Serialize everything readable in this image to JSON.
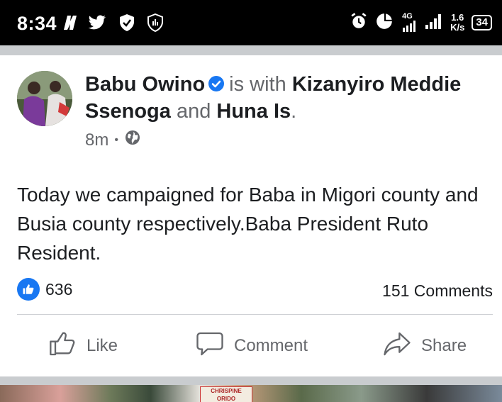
{
  "status_bar": {
    "time": "8:34",
    "network_type": "4G",
    "net_speed_value": "1.6",
    "net_speed_unit": "K/s",
    "battery_level": "34",
    "icons": [
      "netflix-n-icon",
      "twitter-icon",
      "shield-check-icon",
      "shield-app-icon",
      "alarm-icon",
      "data-saver-icon",
      "signal-4g-icon",
      "signal-bars-icon",
      "battery-icon"
    ]
  },
  "post": {
    "author": "Babu Owino",
    "is_with_text": "is with",
    "tagged_1": "Kizanyiro Meddie Ssenoga",
    "and_text": "and",
    "tagged_2": "Huna Is",
    "period": ".",
    "time_ago": "8m",
    "separator": "•",
    "privacy_icon": "globe-icon",
    "body": "Today we campaigned for Baba in Migori county and Busia county respectively.Baba President Ruto Resident.",
    "reaction_count": "636",
    "comments_count": "151 Comments"
  },
  "actions": {
    "like_label": "Like",
    "comment_label": "Comment",
    "share_label": "Share"
  },
  "photo": {
    "sign_line_1": "CHRISPINE",
    "sign_line_2": "ORIDO"
  },
  "colors": {
    "brand_blue": "#1877f2",
    "text_primary": "#1c1e21",
    "text_secondary": "#65676b",
    "status_bar_bg": "#000000",
    "separator_band": "#c9cccf"
  }
}
